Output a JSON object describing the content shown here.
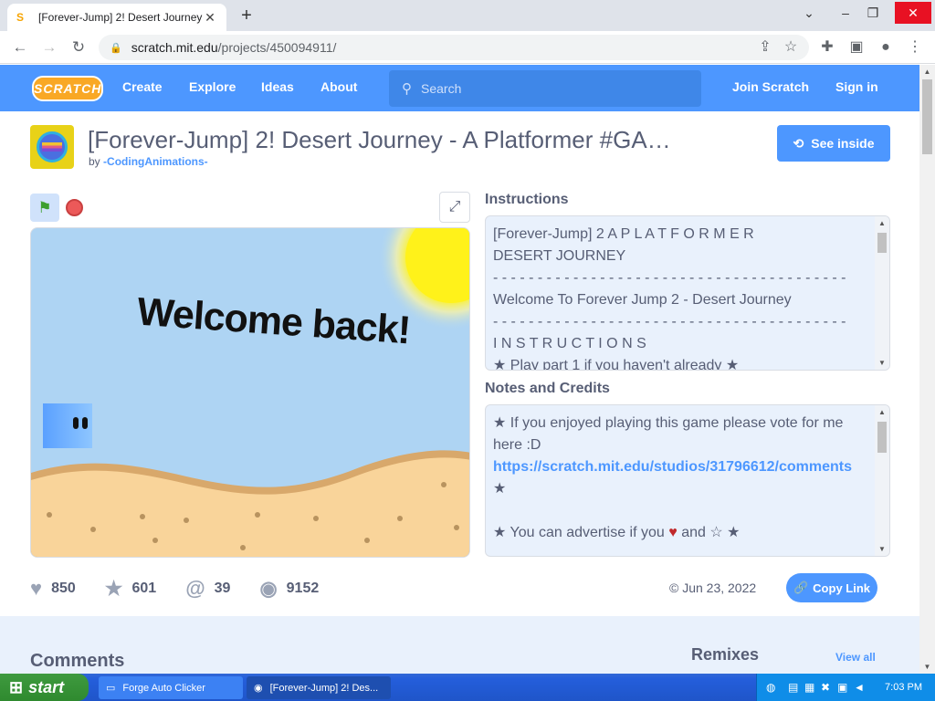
{
  "browser": {
    "tab_title": "[Forever-Jump] 2! Desert Journey",
    "tab_close": "✕",
    "new_tab": "+",
    "url_host": "scratch.mit.edu",
    "url_path": "/projects/450094911/"
  },
  "nav": {
    "logo": "SCRATCH",
    "links": [
      "Create",
      "Explore",
      "Ideas",
      "About"
    ],
    "search_placeholder": "Search",
    "join": "Join Scratch",
    "signin": "Sign in"
  },
  "project": {
    "title": "[Forever-Jump] 2! Desert Journey - A Platformer #GA…",
    "by_prefix": "by",
    "author": "-CodingAnimations-",
    "see_inside": "See inside",
    "stage_text": "Welcome back!",
    "instructions_title": "Instructions",
    "instructions_lines": [
      "[Forever-Jump] 2 A P L A T F O R M E R",
      "DESERT JOURNEY",
      "- - - - - - - - - - - - - - - - - - - - - - - - - - - - - - - - - - - - - - - -",
      "Welcome To Forever Jump 2 - Desert Journey",
      "- - - - - - - - - - - - - - - - - - - - - - - - - - - - - - - - - - - - - - - -",
      "I N S T R U C T I O N S",
      "★ Play part 1 if you haven't already ★"
    ],
    "notes_title": "Notes and Credits",
    "notes_lines": [
      "★ If you enjoyed playing this game please vote for me",
      "here :D",
      "https://scratch.mit.edu/studios/31796612/comments",
      "★",
      "",
      "★ You can advertise if you ♥ and ☆ ★"
    ],
    "stats": {
      "loves": "850",
      "favorites": "601",
      "remixes": "39",
      "views": "9152"
    },
    "date": "© Jun 23, 2022",
    "copy_link": "Copy Link",
    "comments_title": "Comments",
    "remixes_title": "Remixes",
    "view_all": "View all"
  },
  "taskbar": {
    "start": "start",
    "tasks": [
      "Forge Auto Clicker",
      "[Forever-Jump] 2! Des..."
    ],
    "clock": "7:03 PM"
  },
  "colors": {
    "scratch_blue": "#4d97ff",
    "text": "#575e75",
    "heart": "#c0282b"
  }
}
